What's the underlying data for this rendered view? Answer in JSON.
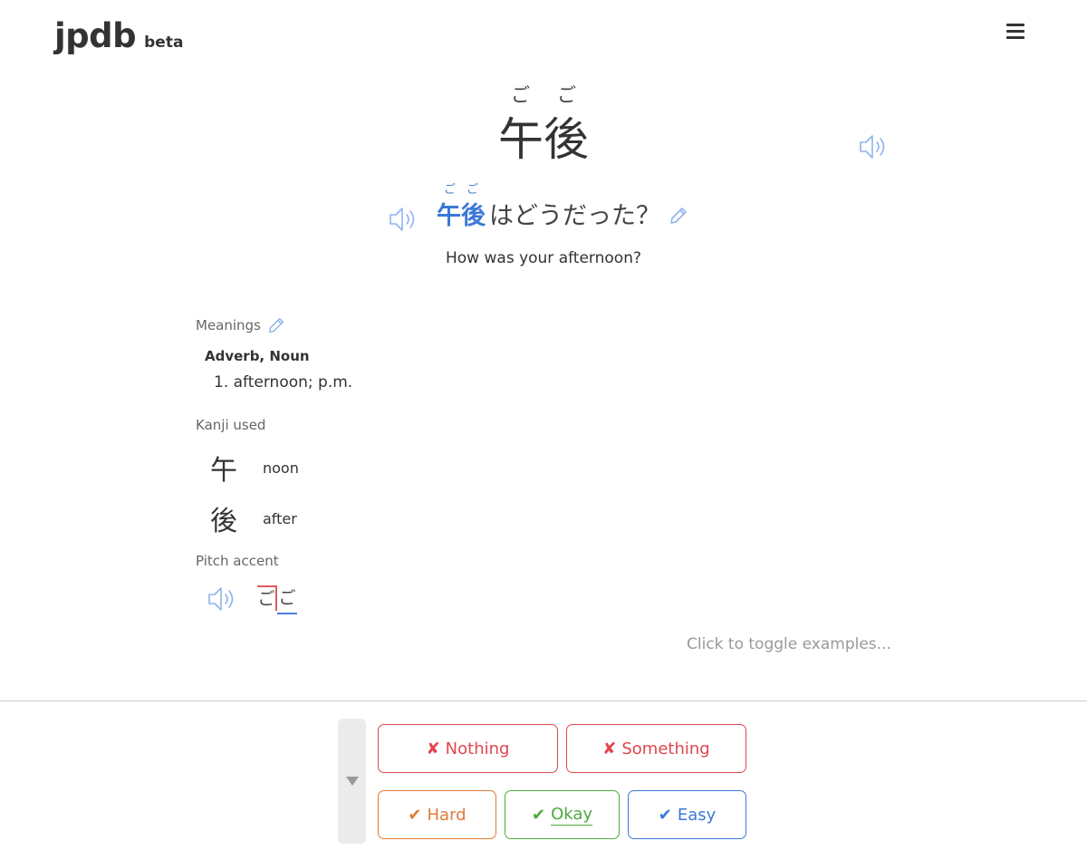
{
  "header": {
    "logo": "jpdb",
    "logo_tag": "beta",
    "menu_icon": "hamburger-menu-icon"
  },
  "word": {
    "furigana": "ごご",
    "spelling": "午後",
    "audio_icon": "speaker-icon"
  },
  "example": {
    "target_furigana": "ごご",
    "target": "午後",
    "rest": "はどうだった？",
    "translation": "How was your afternoon?"
  },
  "meanings": {
    "label": "Meanings",
    "parts_of_speech": "Adverb, Noun",
    "items": [
      "1. afternoon; p.m."
    ]
  },
  "kanji": {
    "label": "Kanji used",
    "items": [
      {
        "char": "午",
        "keyword": "noon"
      },
      {
        "char": "後",
        "keyword": "after"
      }
    ]
  },
  "pitch": {
    "label": "Pitch accent",
    "morae": [
      "ご",
      "ご"
    ],
    "colors": {
      "high": "#e05a5a",
      "low": "#4a80d4"
    }
  },
  "examples_toggle": "Click to toggle examples...",
  "grades": {
    "nothing": "Nothing",
    "something": "Something",
    "hard": "Hard",
    "okay": "Okay",
    "easy": "Easy",
    "fail_mark": "✘",
    "pass_mark": "✔"
  },
  "colors": {
    "fail": "#e0464e",
    "hard": "#e07a38",
    "okay": "#4caa3c",
    "easy": "#3a78d8",
    "accent": "#3a78d8"
  }
}
